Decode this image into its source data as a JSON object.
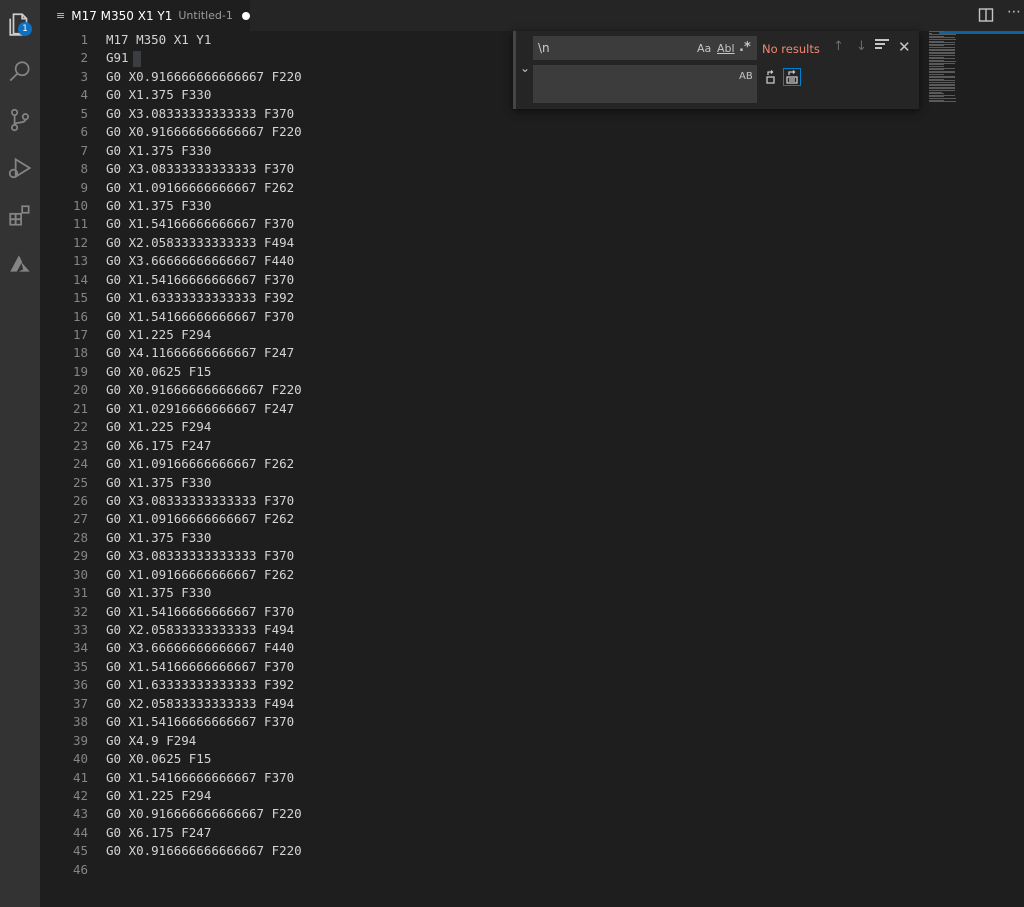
{
  "activity_bar": {
    "explorer_badge": "1",
    "items": [
      "explorer-icon",
      "search-icon",
      "source-control-icon",
      "run-debug-icon",
      "extensions-icon",
      "azure-icon"
    ]
  },
  "tab": {
    "title": "M17 M350 X1 Y1",
    "description": "Untitled-1",
    "dirty": true
  },
  "find_widget": {
    "find_value": "\\n",
    "match_case_label": "Aa",
    "whole_word_label": "Abl",
    "regex_label": ".*",
    "status": "No results",
    "replace_value": "",
    "preserve_case_label": "AB"
  },
  "editor": {
    "lines": [
      "M17 M350 X1 Y1",
      "G91",
      "G0 X0.916666666666667 F220",
      "G0 X1.375 F330",
      "G0 X3.08333333333333 F370",
      "G0 X0.916666666666667 F220",
      "G0 X1.375 F330",
      "G0 X3.08333333333333 F370",
      "G0 X1.09166666666667 F262",
      "G0 X1.375 F330",
      "G0 X1.54166666666667 F370",
      "G0 X2.05833333333333 F494",
      "G0 X3.66666666666667 F440",
      "G0 X1.54166666666667 F370",
      "G0 X1.63333333333333 F392",
      "G0 X1.54166666666667 F370",
      "G0 X1.225 F294",
      "G0 X4.11666666666667 F247",
      "G0 X0.0625 F15",
      "G0 X0.916666666666667 F220",
      "G0 X1.02916666666667 F247",
      "G0 X1.225 F294",
      "G0 X6.175 F247",
      "G0 X1.09166666666667 F262",
      "G0 X1.375 F330",
      "G0 X3.08333333333333 F370",
      "G0 X1.09166666666667 F262",
      "G0 X1.375 F330",
      "G0 X3.08333333333333 F370",
      "G0 X1.09166666666667 F262",
      "G0 X1.375 F330",
      "G0 X1.54166666666667 F370",
      "G0 X2.05833333333333 F494",
      "G0 X3.66666666666667 F440",
      "G0 X1.54166666666667 F370",
      "G0 X1.63333333333333 F392",
      "G0 X2.05833333333333 F494",
      "G0 X1.54166666666667 F370",
      "G0 X4.9 F294",
      "G0 X0.0625 F15",
      "G0 X1.54166666666667 F370",
      "G0 X1.225 F294",
      "G0 X0.916666666666667 F220",
      "G0 X6.175 F247",
      "G0 X0.916666666666667 F220",
      ""
    ]
  },
  "colors": {
    "background": "#1e1e1e",
    "activity_bar": "#333333",
    "no_results": "#f48771",
    "accent": "#0e70c0"
  }
}
